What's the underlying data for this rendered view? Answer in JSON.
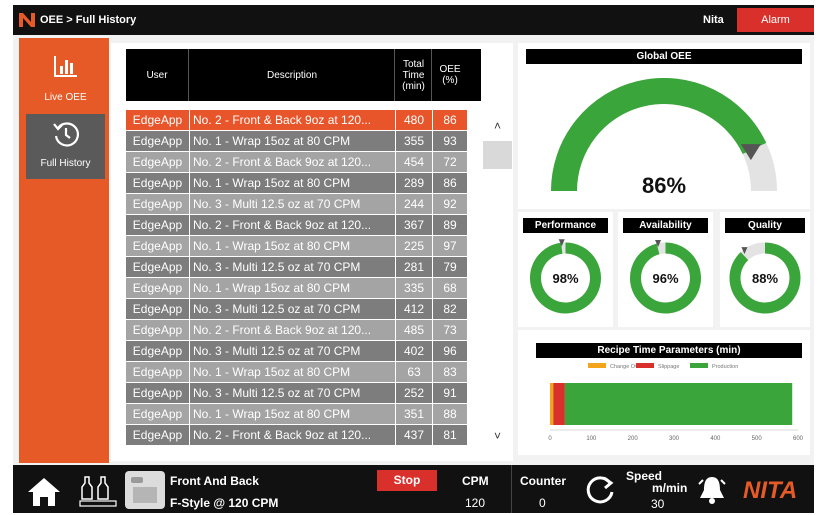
{
  "topbar": {
    "breadcrumb": "OEE > Full History",
    "user": "Nita",
    "alarm": "Alarm"
  },
  "nav": {
    "live_oee": "Live OEE",
    "full_history": "Full History"
  },
  "table": {
    "headers": {
      "user": "User",
      "description": "Description",
      "total_time": "Total Time (min)",
      "oee": "OEE (%)"
    },
    "rows": [
      {
        "user": "EdgeApp",
        "description": "No. 2 - Front & Back 9oz at 120...",
        "total": "480",
        "oee": "86"
      },
      {
        "user": "EdgeApp",
        "description": "No. 1 - Wrap 15oz at 80 CPM",
        "total": "355",
        "oee": "93"
      },
      {
        "user": "EdgeApp",
        "description": "No. 2 - Front & Back 9oz at 120...",
        "total": "454",
        "oee": "72"
      },
      {
        "user": "EdgeApp",
        "description": "No. 1 - Wrap 15oz at 80 CPM",
        "total": "289",
        "oee": "86"
      },
      {
        "user": "EdgeApp",
        "description": "No. 3 - Multi 12.5 oz at 70 CPM",
        "total": "244",
        "oee": "92"
      },
      {
        "user": "EdgeApp",
        "description": "No. 2 - Front & Back 9oz at 120...",
        "total": "367",
        "oee": "89"
      },
      {
        "user": "EdgeApp",
        "description": "No. 1 - Wrap 15oz at 80 CPM",
        "total": "225",
        "oee": "97"
      },
      {
        "user": "EdgeApp",
        "description": "No. 3 - Multi 12.5 oz at 70 CPM",
        "total": "281",
        "oee": "79"
      },
      {
        "user": "EdgeApp",
        "description": "No. 1 - Wrap 15oz at 80 CPM",
        "total": "335",
        "oee": "68"
      },
      {
        "user": "EdgeApp",
        "description": "No. 3 - Multi 12.5 oz at 70 CPM",
        "total": "412",
        "oee": "82"
      },
      {
        "user": "EdgeApp",
        "description": "No. 2 - Front & Back 9oz at 120...",
        "total": "485",
        "oee": "73"
      },
      {
        "user": "EdgeApp",
        "description": "No. 3 - Multi 12.5 oz at 70 CPM",
        "total": "402",
        "oee": "96"
      },
      {
        "user": "EdgeApp",
        "description": "No. 1 - Wrap 15oz at 80 CPM",
        "total": "63",
        "oee": "83"
      },
      {
        "user": "EdgeApp",
        "description": "No. 3 - Multi 12.5 oz at 70 CPM",
        "total": "252",
        "oee": "91"
      },
      {
        "user": "EdgeApp",
        "description": "No. 1 - Wrap 15oz at 80 CPM",
        "total": "351",
        "oee": "88"
      },
      {
        "user": "EdgeApp",
        "description": "No. 2 - Front & Back 9oz at 120...",
        "total": "437",
        "oee": "81"
      }
    ]
  },
  "global_oee": {
    "title": "Global OEE",
    "value": "86%",
    "fraction": 0.86
  },
  "metrics": {
    "performance": {
      "title": "Performance",
      "value": "98%",
      "fraction": 0.98
    },
    "availability": {
      "title": "Availability",
      "value": "96%",
      "fraction": 0.96
    },
    "quality": {
      "title": "Quality",
      "value": "88%",
      "fraction": 0.88
    }
  },
  "chart_data": {
    "type": "bar",
    "title": "Recipe Time Parameters (min)",
    "orientation": "horizontal-stacked",
    "xlim": [
      0,
      600
    ],
    "xticks": [
      "0",
      "100",
      "200",
      "300",
      "400",
      "500",
      "600"
    ],
    "series": [
      {
        "name": "Change Over",
        "values": [
          8
        ]
      },
      {
        "name": "Slippage",
        "values": [
          28
        ]
      },
      {
        "name": "Production",
        "values": [
          550
        ]
      }
    ]
  },
  "colors": {
    "accent": "#e55a26",
    "good": "#3aa53a",
    "alarm": "#d9302c",
    "change_over": "#f2a51a",
    "slippage": "#d9302c",
    "production": "#3aa53a"
  },
  "bottom": {
    "recipe_name": "Front And Back",
    "recipe_format": "F-Style @ 120 CPM",
    "stop": "Stop",
    "cpm_label": "CPM",
    "cpm_value": "120",
    "counter_label": "Counter",
    "counter_value": "0",
    "speed_label": "Speed",
    "speed_unit": "m/min",
    "speed_value": "30",
    "brand": "NITA"
  }
}
